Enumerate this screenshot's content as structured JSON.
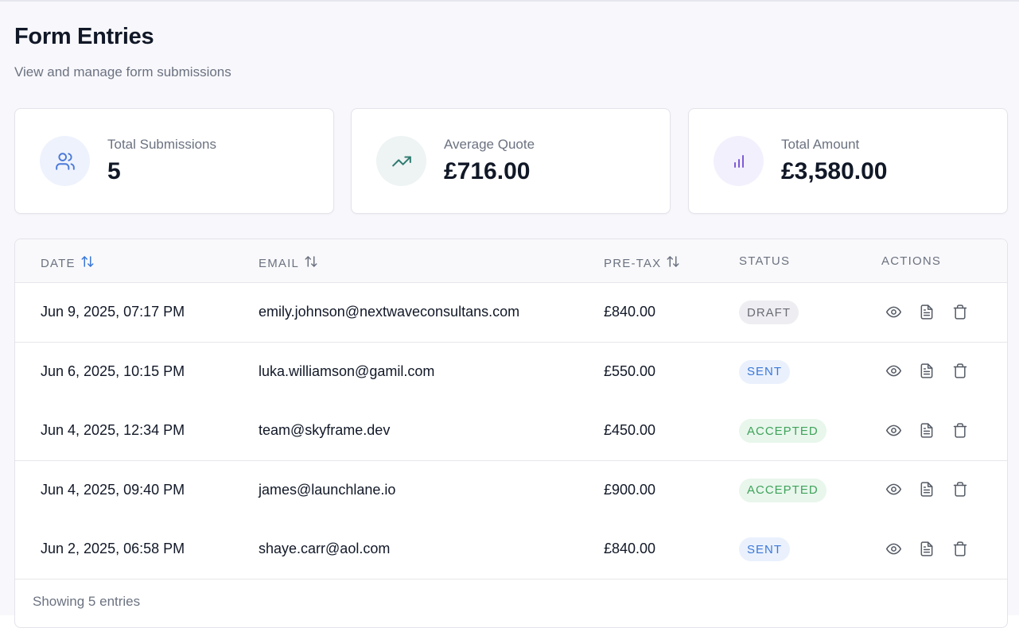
{
  "header": {
    "title": "Form Entries",
    "subtitle": "View and manage form submissions"
  },
  "stats": [
    {
      "label": "Total Submissions",
      "value": "5",
      "icon": "users-icon",
      "bg": "#eef2fd",
      "color": "#4a79d9"
    },
    {
      "label": "Average Quote",
      "value": "£716.00",
      "icon": "trending-up-icon",
      "bg": "#eef3f3",
      "color": "#2d7a6f"
    },
    {
      "label": "Total Amount",
      "value": "£3,580.00",
      "icon": "bar-chart-icon",
      "bg": "#f3f0fd",
      "color": "#7c5bd6"
    }
  ],
  "table": {
    "columns": {
      "date": "DATE",
      "email": "EMAIL",
      "pretax": "PRE-TAX",
      "status": "STATUS",
      "actions": "ACTIONS"
    },
    "rows": [
      {
        "date": "Jun 9, 2025, 07:17 PM",
        "email": "emily.johnson@nextwaveconsultans.com",
        "pretax": "£840.00",
        "status": "DRAFT"
      },
      {
        "date": "Jun 6, 2025, 10:15 PM",
        "email": "luka.williamson@gamil.com",
        "pretax": "£550.00",
        "status": "SENT"
      },
      {
        "date": "Jun 4, 2025, 12:34 PM",
        "email": "team@skyframe.dev",
        "pretax": "£450.00",
        "status": "ACCEPTED"
      },
      {
        "date": "Jun 4, 2025, 09:40 PM",
        "email": "james@launchlane.io",
        "pretax": "£900.00",
        "status": "ACCEPTED"
      },
      {
        "date": "Jun 2, 2025, 06:58 PM",
        "email": "shaye.carr@aol.com",
        "pretax": "£840.00",
        "status": "SENT"
      }
    ],
    "status_styles": {
      "DRAFT": {
        "bg": "#eeeef2",
        "color": "#6b6b76"
      },
      "SENT": {
        "bg": "#eaf1fd",
        "color": "#3b78d8"
      },
      "ACCEPTED": {
        "bg": "#e8f6ec",
        "color": "#3fa35a"
      }
    },
    "sort_active_color": "#3b78d8",
    "footer": "Showing 5 entries"
  }
}
